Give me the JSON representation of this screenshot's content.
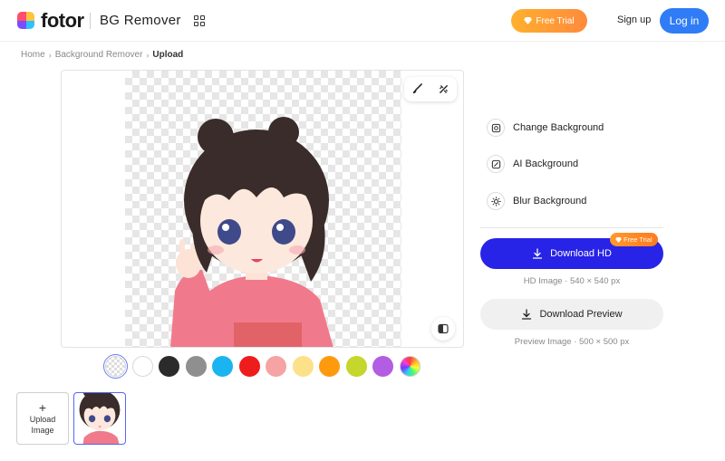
{
  "header": {
    "brand": "fotor",
    "product": "BG Remover",
    "free_trial": "Free Trial",
    "signup": "Sign up",
    "login": "Log in"
  },
  "breadcrumb": {
    "items": [
      "Home",
      "Background Remover"
    ],
    "current": "Upload"
  },
  "canvas": {
    "tools": [
      "brush-icon",
      "magic-wand-icon"
    ],
    "compare_icon": "compare-icon"
  },
  "swatches": [
    {
      "color": "transparent",
      "selected": true
    },
    {
      "color": "#ffffff"
    },
    {
      "color": "#2b2b2b"
    },
    {
      "color": "#8f8f8f"
    },
    {
      "color": "#1ab5f0"
    },
    {
      "color": "#ee1c1c"
    },
    {
      "color": "#f5a3a3"
    },
    {
      "color": "#fde08a"
    },
    {
      "color": "#ff9a0f"
    },
    {
      "color": "#c5d62c"
    },
    {
      "color": "#b25de3"
    },
    {
      "color": "rainbow"
    }
  ],
  "thumbs": {
    "upload_plus": "+",
    "upload_line1": "Upload",
    "upload_line2": "Image"
  },
  "options": [
    {
      "label": "Change Background",
      "icon": "change-background-icon"
    },
    {
      "label": "AI Background",
      "icon": "ai-background-icon"
    },
    {
      "label": "Blur Background",
      "icon": "blur-background-icon"
    }
  ],
  "download": {
    "hd_label": "Download HD",
    "hd_badge": "Free Trial",
    "hd_info": "HD Image · 540 × 540 px",
    "preview_label": "Download Preview",
    "preview_info": "Preview Image · 500 × 500 px"
  },
  "colors": {
    "accent": "#2723e7",
    "login": "#2f7cf6",
    "trial": "#ff9a2e"
  }
}
